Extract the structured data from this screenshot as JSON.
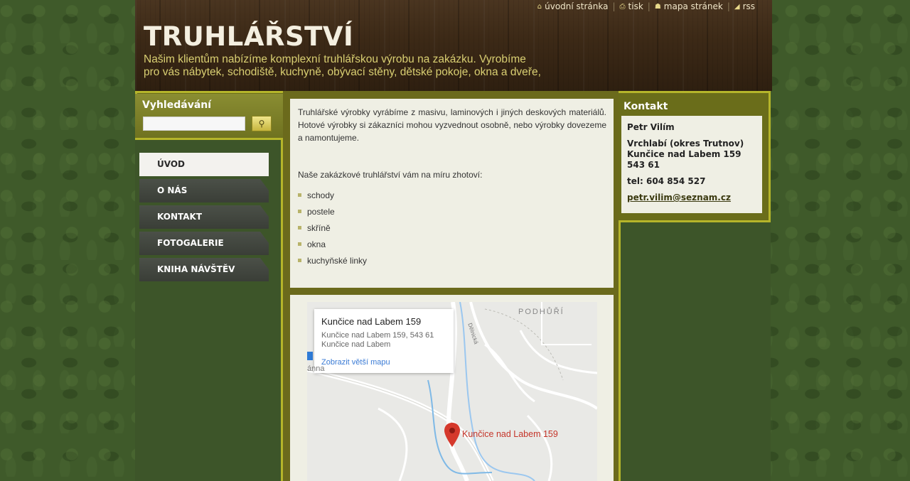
{
  "topnav": {
    "home": "úvodní stránka",
    "print": "tisk",
    "sitemap": "mapa stránek",
    "rss": "rss"
  },
  "header": {
    "title": "TRUHLÁŘSTVÍ",
    "slogan_line1": "Našim klientům nabízíme komplexní truhlářskou výrobu na zakázku. Vyrobíme",
    "slogan_line2": "pro vás nábytek, schodiště, kuchyně, obývací stěny, dětské pokoje, okna a dveře,"
  },
  "search": {
    "title": "Vyhledávání",
    "value": "",
    "button_icon": "magnifier-icon"
  },
  "menu": {
    "items": [
      {
        "label": "ÚVOD",
        "active": true
      },
      {
        "label": "O NÁS"
      },
      {
        "label": "KONTAKT"
      },
      {
        "label": "FOTOGALERIE"
      },
      {
        "label": "KNIHA NÁVŠTĚV"
      }
    ]
  },
  "content": {
    "intro": "Truhlářské výrobky vyrábíme z masivu, laminových i jiných deskových materiálů. Hotové výrobky si zákazníci mohou vyzvednout osobně, nebo výrobky dovezeme a namontujeme.",
    "list_intro": "Naše zakázkové truhlářství vám na míru zhotoví:",
    "list": [
      "schody",
      "postele",
      "skříně",
      "okna",
      "kuchyňské linky"
    ]
  },
  "map": {
    "card_title": "Kunčice nad Labem 159",
    "card_address1": "Kunčice nad Labem 159, 543 61",
    "card_address2": "Kunčice nad Labem",
    "card_link": "Zobrazit větší mapu",
    "area_label": "PODHŮŘÍ",
    "pin_label": "Kunčice nad Labem 159",
    "road_label": "Dělnická",
    "fragment_label": "ánna"
  },
  "contact": {
    "title": "Kontakt",
    "name": "Petr Vilím",
    "city": "Vrchlabí (okres Trutnov)",
    "street": "Kunčice nad Labem 159",
    "zip": "543 61",
    "phone": "tel: 604 854 527",
    "email": "petr.vilim@seznam.cz"
  },
  "colors": {
    "olive": "#6a6d1a",
    "border": "#b5b52a",
    "slogan": "#d9cf72",
    "pin": "#d5392c"
  }
}
